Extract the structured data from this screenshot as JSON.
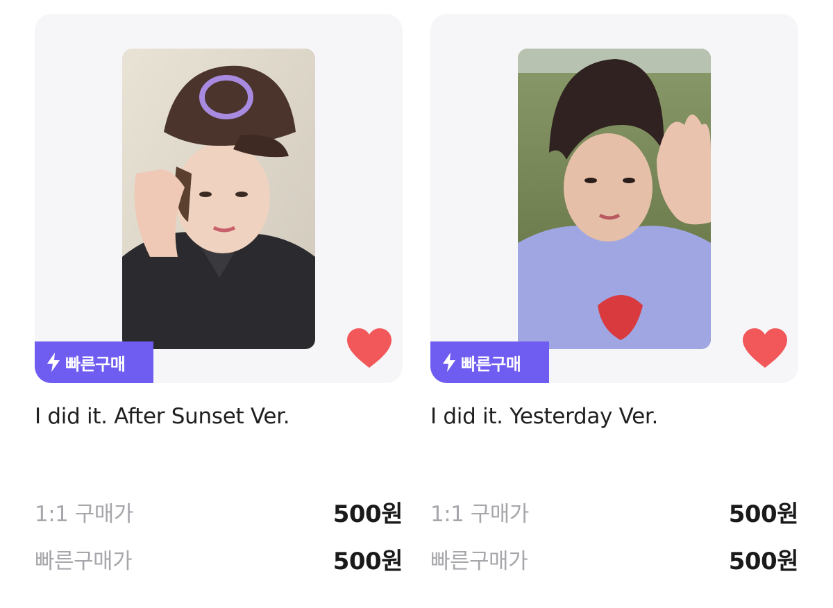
{
  "products": [
    {
      "title": "I did it. After Sunset Ver.",
      "badge": "빠른구매",
      "price_rows": [
        {
          "label": "1:1 구매가",
          "value": "500원"
        },
        {
          "label": "빠른구매가",
          "value": "500원"
        }
      ],
      "favorited": true
    },
    {
      "title": "I did it. Yesterday Ver.",
      "badge": "빠른구매",
      "price_rows": [
        {
          "label": "1:1 구매가",
          "value": "500원"
        },
        {
          "label": "빠른구매가",
          "value": "500원"
        }
      ],
      "favorited": true
    }
  ],
  "colors": {
    "badge_bg": "#6f5cf1",
    "heart": "#f2575a",
    "card_bg": "#f6f6f8",
    "label_gray": "#a6a6ab"
  },
  "icons": {
    "badge_icon": "lightning-icon",
    "favorite_icon": "heart-icon"
  }
}
